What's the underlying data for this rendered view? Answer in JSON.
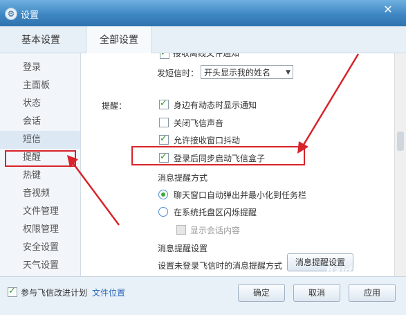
{
  "window": {
    "title": "设置",
    "close_glyph": "✕"
  },
  "tabs": [
    "基本设置",
    "全部设置"
  ],
  "sidebar": {
    "items": [
      "登录",
      "主面板",
      "状态",
      "会话",
      "短信",
      "提醒",
      "热键",
      "音视频",
      "文件管理",
      "权限管理",
      "安全设置",
      "天气设置"
    ],
    "active_index": 4
  },
  "content": {
    "cut_top_label": "接收离线文件通知",
    "sms_label": "发短信时：",
    "sms_select_value": "开头显示我的姓名",
    "remind_label": "提醒：",
    "checkboxes": [
      {
        "label": "身边有动态时显示通知",
        "checked": true
      },
      {
        "label": "关闭飞信声音",
        "checked": false
      },
      {
        "label": "允许接收窗口抖动",
        "checked": true
      },
      {
        "label": "登录后同步启动飞信盒子",
        "checked": true
      }
    ],
    "msg_mode_title": "消息提醒方式",
    "radios": [
      {
        "label": "聊天窗口自动弹出并最小化到任务栏",
        "checked": true
      },
      {
        "label": "在系统托盘区闪烁提醒",
        "checked": false
      }
    ],
    "show_session_label": "显示会话内容",
    "msg_setting_title": "消息提醒设置",
    "msg_setting_desc": "设置未登录飞信时的消息提醒方式",
    "msg_setting_button": "消息提醒设置"
  },
  "footer": {
    "improve_label": "参与飞信改进计划",
    "file_location_link": "文件位置",
    "ok": "确定",
    "cancel": "取消",
    "apply": "应用"
  },
  "watermark": "Baidu 经验",
  "colors": {
    "title_bar": "#3f87c4",
    "highlight": "#d8232a",
    "link": "#2a68b8",
    "check": "#2a9a2a"
  }
}
